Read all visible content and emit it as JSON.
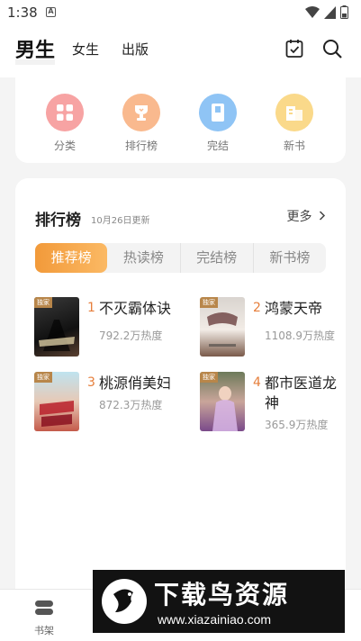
{
  "status": {
    "time": "1:38",
    "notif": "A"
  },
  "header": {
    "tab_active": "男生",
    "tab_female": "女生",
    "tab_publish": "出版"
  },
  "categories": [
    {
      "label": "分类",
      "color": "#f7a3a3",
      "icon": "grid-icon"
    },
    {
      "label": "排行榜",
      "color": "#f9b98e",
      "icon": "trophy-icon"
    },
    {
      "label": "完结",
      "color": "#8fc4f5",
      "icon": "book-icon"
    },
    {
      "label": "新书",
      "color": "#fad98a",
      "icon": "new-book-icon"
    }
  ],
  "ranking": {
    "title": "排行榜",
    "date": "10月26日更新",
    "more": "更多",
    "tabs": [
      "推荐榜",
      "热读榜",
      "完结榜",
      "新书榜"
    ],
    "books": [
      {
        "num": "1",
        "name": "不灭霸体诀",
        "heat": "792.2万热度",
        "tag": "独家"
      },
      {
        "num": "2",
        "name": "鸿蒙天帝",
        "heat": "1108.9万热度",
        "tag": "独家"
      },
      {
        "num": "3",
        "name": "桃源俏美妇",
        "heat": "872.3万热度",
        "tag": "独家"
      },
      {
        "num": "4",
        "name": "都市医道龙神",
        "heat": "365.9万热度",
        "tag": "独家"
      }
    ]
  },
  "nav": {
    "shelf": "书架"
  },
  "watermark": {
    "title": "下载鸟资源",
    "url": "www.xiazainiao.com"
  },
  "colors": {
    "accent": "#f29a3a",
    "rank_num": "#e67e3b"
  }
}
